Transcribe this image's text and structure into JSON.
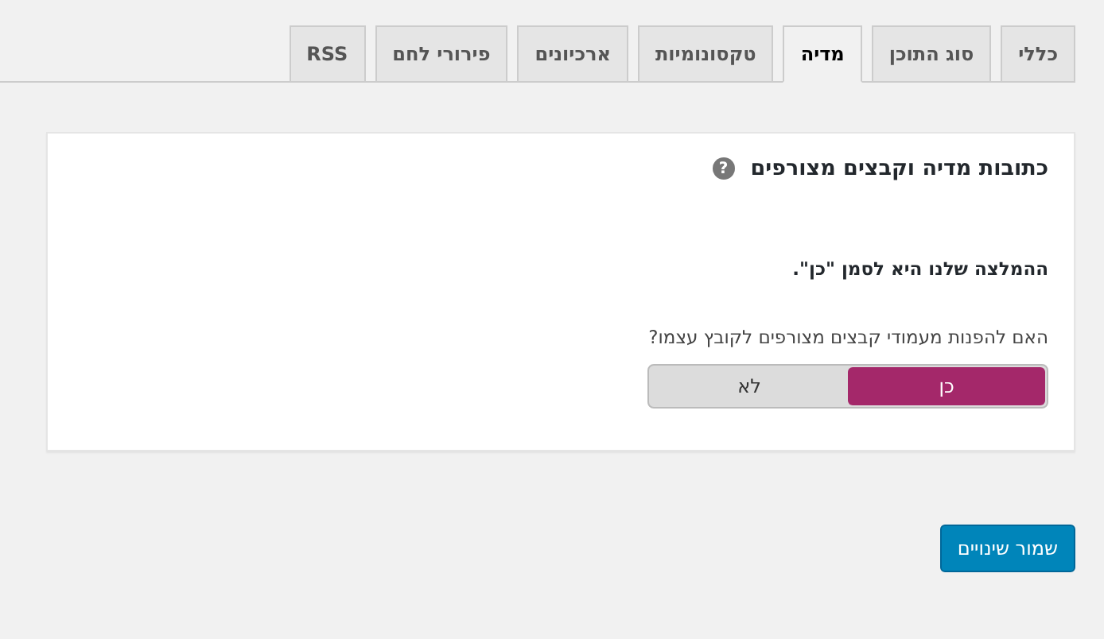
{
  "tabs": [
    {
      "label": "כללי",
      "selected": false
    },
    {
      "label": "סוג התוכן",
      "selected": false
    },
    {
      "label": "מדיה",
      "selected": true
    },
    {
      "label": "טקסונומיות",
      "selected": false
    },
    {
      "label": "ארכיונים",
      "selected": false
    },
    {
      "label": "פירורי לחם",
      "selected": false
    },
    {
      "label": "RSS",
      "selected": false
    }
  ],
  "card": {
    "title": "כתובות מדיה וקבצים מצורפים",
    "help_icon": "?",
    "recommendation": "ההמלצה שלנו היא לסמן \"כן\".",
    "question": "האם להפנות מעמודי קבצים מצורפים לקובץ עצמו?",
    "toggle": [
      {
        "label": "כן",
        "selected": true
      },
      {
        "label": "לא",
        "selected": false
      }
    ]
  },
  "save_button": "שמור שינויים"
}
